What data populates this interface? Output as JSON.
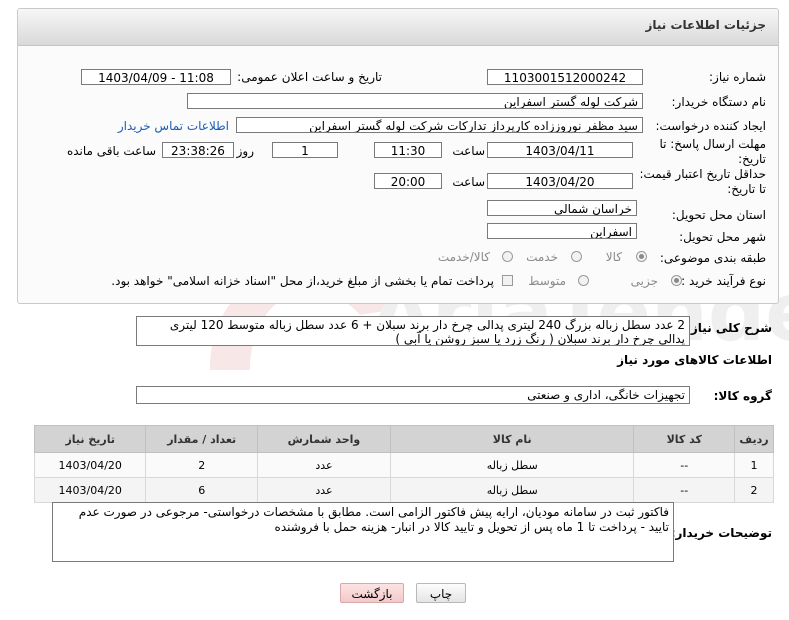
{
  "header": {
    "title": "جزئیات اطلاعات نیاز"
  },
  "need_number": {
    "label": "شماره نیاز:",
    "value": "1103001512000242"
  },
  "announce_datetime": {
    "label": "تاریخ و ساعت اعلان عمومی:",
    "value": "1403/04/09 - 11:08"
  },
  "buyer_org": {
    "label": "نام دستگاه خریدار:",
    "value": "شرکت لوله گستر اسفراین"
  },
  "requester": {
    "label": "ایجاد کننده درخواست:",
    "value": "سید مظفر نوروززاده کارپرداز تدارکات شرکت لوله گستر اسفراین",
    "contact_link": "اطلاعات تماس خریدار"
  },
  "reply_deadline": {
    "label": "مهلت ارسال پاسخ: تا تاریخ:",
    "date": "1403/04/11",
    "time_label": "ساعت",
    "time": "11:30",
    "days": "1",
    "days_label": "روز و",
    "remaining": "23:38:26",
    "remaining_label": "ساعت باقی مانده"
  },
  "price_validity": {
    "label": "حداقل تاریخ اعتبار قیمت: تا تاریخ:",
    "date": "1403/04/20",
    "time_label": "ساعت",
    "time": "20:00"
  },
  "province": {
    "label": "استان محل تحویل:",
    "value": "خراسان شمالی"
  },
  "city": {
    "label": "شهر محل تحویل:",
    "value": "اسفراین"
  },
  "category": {
    "label": "طبقه بندی موضوعی:",
    "options": [
      "کالا",
      "خدمت",
      "کالا/خدمت"
    ]
  },
  "purchase_type": {
    "label": "نوع فرآیند خرید :",
    "options": [
      "جزیی",
      "متوسط"
    ],
    "payment_note": "پرداخت تمام یا بخشی از مبلغ خرید،از محل \"اسناد خزانه اسلامی\" خواهد بود."
  },
  "summary": {
    "label": "شرح کلی نیاز:",
    "text": "2 عدد سطل زباله بزرگ 240 لیتری پدالی چرخ دار برند سبلان + 6 عدد سطل زباله متوسط 120 لیتری پدالی چرخ دار برند سبلان ( رنگ زرد یا سبز روشن یا آبی )"
  },
  "goods_info": {
    "title": "اطلاعات کالاهای مورد نیاز"
  },
  "goods_group": {
    "label": "گروه کالا:",
    "value": "تجهیزات خانگی، اداری و صنعتی"
  },
  "table": {
    "headers": [
      "ردیف",
      "کد کالا",
      "نام کالا",
      "واحد شمارش",
      "تعداد / مقدار",
      "تاریخ نیاز"
    ],
    "rows": [
      [
        "1",
        "--",
        "سطل زباله",
        "عدد",
        "2",
        "1403/04/20"
      ],
      [
        "2",
        "--",
        "سطل زباله",
        "عدد",
        "6",
        "1403/04/20"
      ]
    ]
  },
  "buyer_notes": {
    "label": "توضیحات خریدار:",
    "text": "فاکتور ثبت در سامانه مودیان، ارایه پیش فاکتور الزامی است. مطابق با مشخصات درخواستی- مرجوعی در صورت عدم تایید - پرداخت تا 1 ماه پس از تحویل و تایید کالا در انبار- هزینه حمل با فروشنده"
  },
  "buttons": {
    "print": "چاپ",
    "back": "بازگشت"
  },
  "watermark": "AriaTender.neT"
}
